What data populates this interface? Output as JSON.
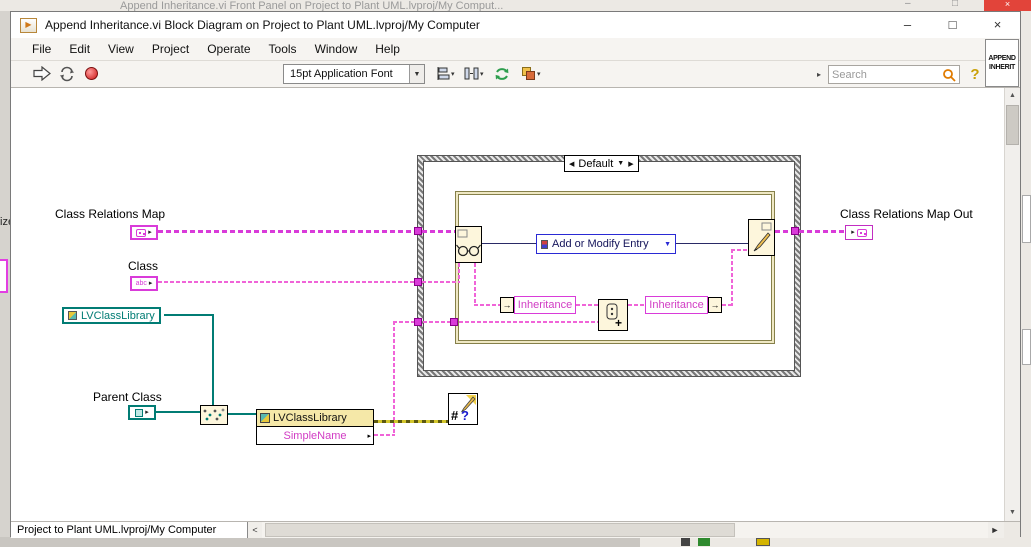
{
  "bg_window": {
    "title": "Append Inheritance.vi Front Panel on Project to Plant UML.lvproj/My Comput...",
    "minimize": "–",
    "maximize": "□",
    "close": "×"
  },
  "window": {
    "title": "Append Inheritance.vi Block Diagram on Project to Plant UML.lvproj/My Computer",
    "minimize": "–",
    "maximize": "□",
    "close": "×"
  },
  "menu": {
    "items": [
      "File",
      "Edit",
      "View",
      "Project",
      "Operate",
      "Tools",
      "Window",
      "Help"
    ]
  },
  "toolbar": {
    "font_selector": "15pt Application Font",
    "search_placeholder": "Search",
    "help_label": "?",
    "vi_icon_line1": "APPEND",
    "vi_icon_line2": "INHERIT"
  },
  "diagram": {
    "labels": {
      "class_relations_map": "Class Relations Map",
      "class": "Class",
      "parent_class": "Parent Class",
      "class_relations_map_out": "Class Relations Map Out"
    },
    "class_terminal_text": "abc",
    "lvclass_constant": "LVClassLibrary",
    "case_selector": "Default",
    "map_config_dropdown": "Add or Modify Entry",
    "unbundle_field": "Inheritance",
    "bundle_field": "Inheritance",
    "property_node": {
      "class_name": "LVClassLibrary",
      "property": "SimpleName"
    },
    "colors": {
      "map_wire": "#D93BD9",
      "string_wire": "#F064D8",
      "class_wire": "#017C74",
      "error_wire": "#C9BD2A",
      "node_fill": "#FDF6DC",
      "dropdown_border": "#2A2AD4"
    }
  },
  "statusbar": {
    "context_tab": "Project to Plant UML.lvproj/My Computer",
    "scroll_left": "<"
  },
  "fragments": {
    "left_text": "ize"
  }
}
